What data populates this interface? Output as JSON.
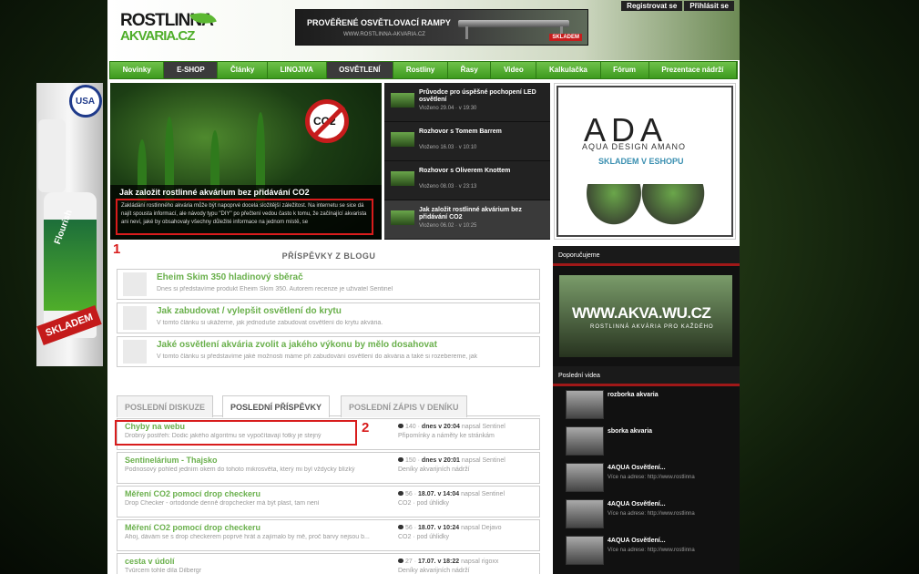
{
  "header": {
    "logo_line1": "ROSTLINNA",
    "logo_line2": "AKVARIA.CZ",
    "banner_text": "PROVĚŘENÉ OSVĚTLOVACÍ RAMPY",
    "banner_url": "WWW.ROSTLINNA-AKVARIA.CZ",
    "banner_badge": "SKLADEM",
    "top_links": [
      "Registrovat se",
      "Přihlásit se"
    ]
  },
  "nav": {
    "items": [
      "Novinky",
      "E-SHOP",
      "Články",
      "LINOJIVA",
      "OSVĚTLENÍ",
      "Rostliny",
      "Řasy",
      "Video",
      "Kalkulačka",
      "Fórum",
      "Prezentace nádrží"
    ]
  },
  "featured": {
    "title": "Jak založit rostlinné akvárium bez přidávání CO2",
    "desc": "Zakládání rostlinného akvária může být napoprvé docela složitější záležitost. Na internetu se sice dá najít spousta informací, ale návody typu \"DIY\" po přečtení vedou často k tomu, že začínající akvarista ani neví, jaké by obsahovaly všechny důležité informace na jednom místě, se",
    "no_co2_label": "CO2"
  },
  "articles": [
    {
      "title": "Průvodce pro úspěšné pochopení LED osvětlení",
      "date": "Vloženo 29.04 · v 19:30"
    },
    {
      "title": "Rozhovor s Tomem Barrem",
      "date": "Vloženo 16.03 · v 10:10"
    },
    {
      "title": "Rozhovor s Oliverem Knottem",
      "date": "Vloženo 08.03 · v 23:13"
    },
    {
      "title": "Jak založit rostlinné akvárium bez přidávání CO2",
      "date": "Vloženo 06.02 · v 10:25"
    }
  ],
  "ada_ad": {
    "logo": "ADA",
    "subtitle": "AQUA DESIGN AMANO",
    "stock": "SKLADEM V ESHOPU"
  },
  "blog": {
    "heading": "PŘÍSPĚVKY Z BLOGU",
    "posts": [
      {
        "title": "Eheim Skim 350 hladinový sběrač",
        "desc": "Dnes si představíme produkt Eheim Skim 350. Autorem recenze je uživatel Sentinel"
      },
      {
        "title": "Jak zabudovat / vylepšit osvětlení do krytu",
        "desc": "V tomto článku si ukážeme, jak jednoduše zabudovat osvětlení do krytu akvária."
      },
      {
        "title": "Jaké osvětlení akvária zvolit a jakého výkonu by mělo dosahovat",
        "desc": "V tomto článku si představíme jaké možnosti máme při zabudování osvětlení do akvária a také si rozebereme, jak"
      }
    ]
  },
  "tabs": {
    "items": [
      "POSLEDNÍ DISKUZE",
      "POSLEDNÍ PŘÍSPĚVKY",
      "POSLEDNÍ ZÁPIS V DENÍKU"
    ],
    "active": "POSLEDNÍ PŘÍSPĚVKY"
  },
  "posts": [
    {
      "title": "Chyby na webu",
      "desc": "Drobný postřeh: Dodic jakého algoritmu se vypočítavají fotky je stejný",
      "count": "140",
      "when": "dnes v 20:04",
      "author": "napsal Sentinel",
      "sub": "Připomínky a náměty ke stránkám"
    },
    {
      "title": "Sentinelárium - Thajsko",
      "desc": "Podnosový pohled jedním okem do tohoto mikrosvěta, který mi byl vždycky blízký",
      "count": "150",
      "when": "dnes v 20:01",
      "author": "napsal Sentinel",
      "sub": "Deníky akvarijních nádrží"
    },
    {
      "title": "Měření CO2 pomocí drop checkeru",
      "desc": "Drop Checker  - ortodonde denně dropchecker má být plast, tam není",
      "count": "56",
      "when": "18.07. v 14:04",
      "author": "napsal Sentinel",
      "sub": "CO2 · pod úhlidky"
    },
    {
      "title": "Měření CO2 pomocí drop checkeru",
      "desc": "Ahoj, dávám se s drop checkerem poprvé hrát a zajímalo by mě, proč barvy nejsou b...",
      "count": "56",
      "when": "18.07. v 10:24",
      "author": "napsal Dejavo",
      "sub": "CO2 · pod úhlidky"
    },
    {
      "title": "cesta v údolí",
      "desc": "Tvůrcem tohle díla Dilbergr",
      "count": "27",
      "when": "17.07. v 18:22",
      "author": "napsal rigoxx",
      "sub": "Deníky akvarijních nádrží"
    }
  ],
  "sidebar": {
    "recommend_heading": "Doporučujeme",
    "akva_url": "WWW.AKVA.WU.CZ",
    "akva_sub": "ROSTLINNÁ AKVÁRIA PRO KAŽDÉHO",
    "videos_heading": "Poslední videa",
    "videos": [
      {
        "title": "rozborka akvaria",
        "desc": ""
      },
      {
        "title": "sborka akvaria",
        "desc": ""
      },
      {
        "title": "4AQUA Osvětlení...",
        "desc": "Více na adrese: http://www.rostlinna"
      },
      {
        "title": "4AQUA Osvětlení...",
        "desc": "Více na adrese: http://www.rostlinna"
      },
      {
        "title": "4AQUA Osvětlení...",
        "desc": "Více na adrese: http://www.rostlinna"
      }
    ]
  },
  "left_ad": {
    "usa": "USA",
    "product": "Flourish",
    "sklade": "SKLADEM"
  },
  "annotations": [
    "1",
    "2"
  ]
}
